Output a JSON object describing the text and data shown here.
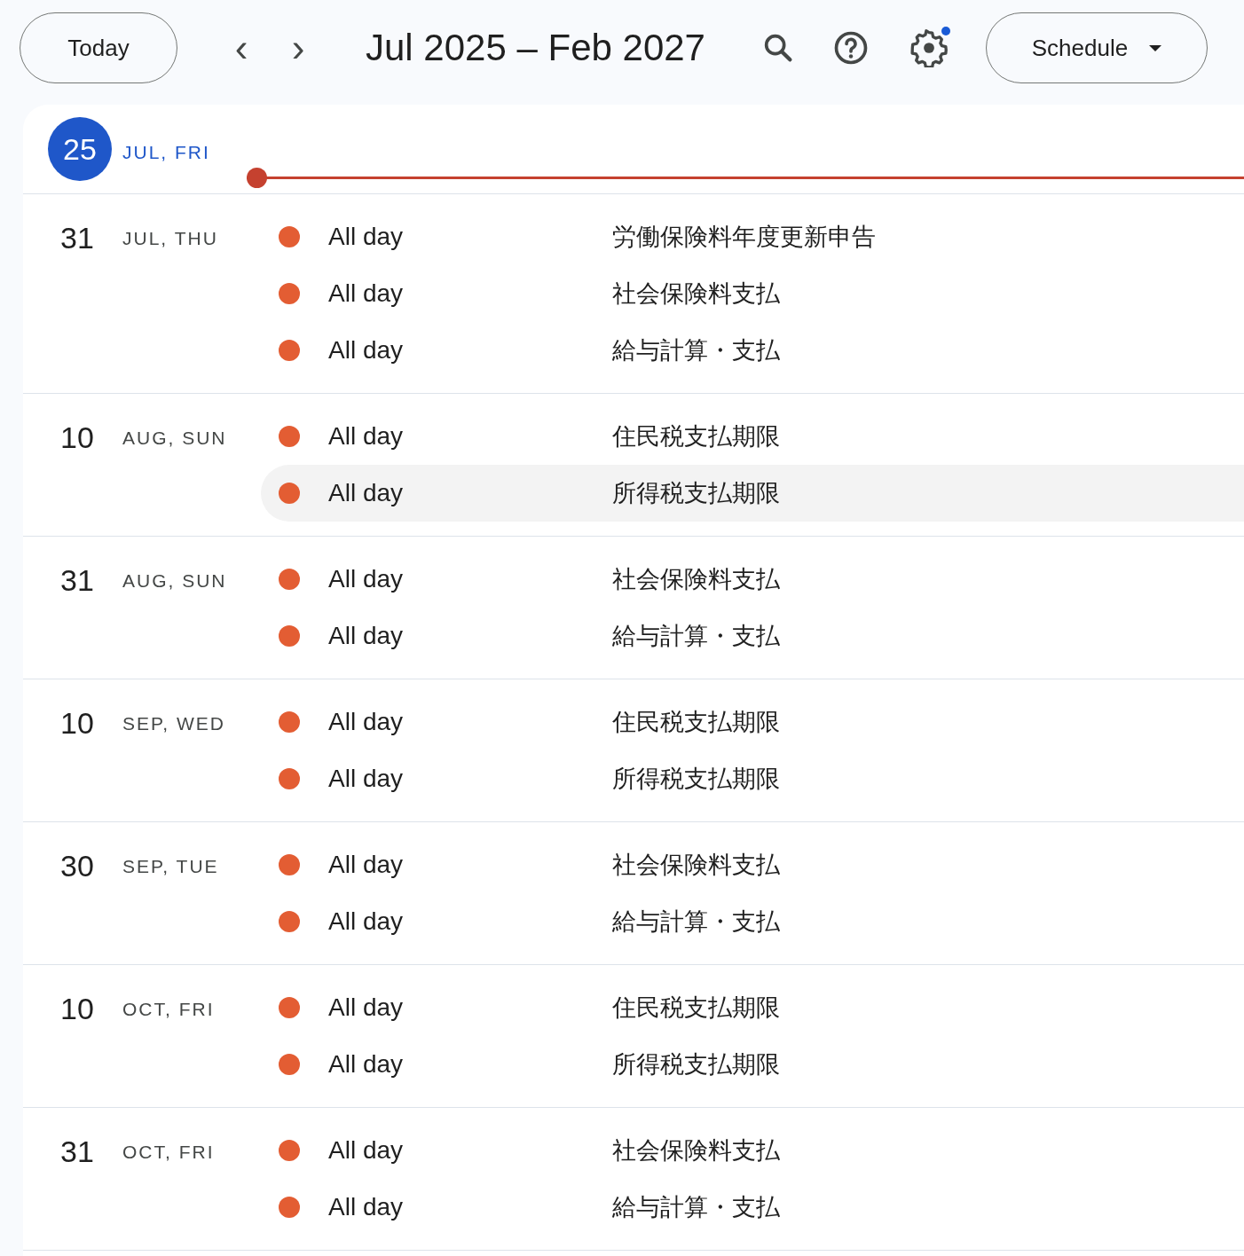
{
  "toolbar": {
    "today_button": "Today",
    "prev": "‹",
    "next": "›",
    "range_title": "Jul 2025 – Feb 2027",
    "settings_notification": true,
    "view_button": "Schedule"
  },
  "today": {
    "day": "25",
    "label": "JUL, FRI"
  },
  "days": [
    {
      "day": "31",
      "label": "JUL, THU",
      "events": [
        {
          "time": "All day",
          "title": "労働保険料年度更新申告",
          "highlighted": false
        },
        {
          "time": "All day",
          "title": "社会保険料支払",
          "highlighted": false
        },
        {
          "time": "All day",
          "title": "給与計算・支払",
          "highlighted": false
        }
      ]
    },
    {
      "day": "10",
      "label": "AUG, SUN",
      "events": [
        {
          "time": "All day",
          "title": "住民税支払期限",
          "highlighted": false
        },
        {
          "time": "All day",
          "title": "所得税支払期限",
          "highlighted": true
        }
      ]
    },
    {
      "day": "31",
      "label": "AUG, SUN",
      "events": [
        {
          "time": "All day",
          "title": "社会保険料支払",
          "highlighted": false
        },
        {
          "time": "All day",
          "title": "給与計算・支払",
          "highlighted": false
        }
      ]
    },
    {
      "day": "10",
      "label": "SEP, WED",
      "events": [
        {
          "time": "All day",
          "title": "住民税支払期限",
          "highlighted": false
        },
        {
          "time": "All day",
          "title": "所得税支払期限",
          "highlighted": false
        }
      ]
    },
    {
      "day": "30",
      "label": "SEP, TUE",
      "events": [
        {
          "time": "All day",
          "title": "社会保険料支払",
          "highlighted": false
        },
        {
          "time": "All day",
          "title": "給与計算・支払",
          "highlighted": false
        }
      ]
    },
    {
      "day": "10",
      "label": "OCT, FRI",
      "events": [
        {
          "time": "All day",
          "title": "住民税支払期限",
          "highlighted": false
        },
        {
          "time": "All day",
          "title": "所得税支払期限",
          "highlighted": false
        }
      ]
    },
    {
      "day": "31",
      "label": "OCT, FRI",
      "events": [
        {
          "time": "All day",
          "title": "社会保険料支払",
          "highlighted": false
        },
        {
          "time": "All day",
          "title": "給与計算・支払",
          "highlighted": false
        }
      ]
    }
  ]
}
